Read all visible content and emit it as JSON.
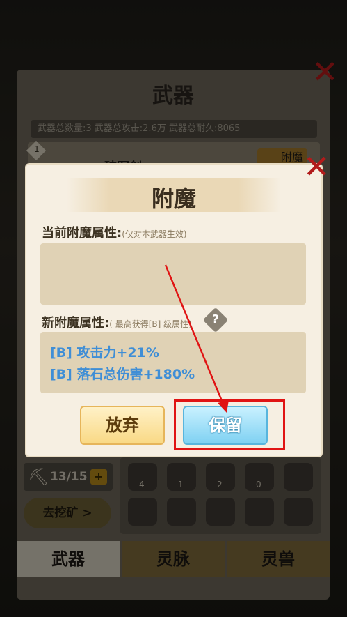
{
  "background": {
    "panel_title": "武器",
    "stats_text": "武器总数量:3  武器总攻击:2.6万  武器总耐久:8065",
    "weapon_level": "1",
    "weapon_name": "破军剑",
    "enchant_tag": "附魔",
    "pickaxe_count": "13/15",
    "plus_label": "+",
    "mine_button": "去挖矿 >",
    "ores": [
      "4",
      "1",
      "2",
      "0"
    ],
    "tabs": [
      "武器",
      "灵脉",
      "灵兽"
    ]
  },
  "dialog": {
    "title": "附魔",
    "current_label": "当前附魔属性:",
    "current_hint": "(仅对本武器生效)",
    "new_label": "新附魔属性:",
    "new_hint": "( 最高获得[B] 级属性)",
    "help_icon": "?",
    "new_attributes": [
      {
        "grade": "[B]",
        "text": "攻击力+21%"
      },
      {
        "grade": "[B]",
        "text": "落石总伤害+180%"
      }
    ],
    "abandon_button": "放弃",
    "keep_button": "保留"
  },
  "colors": {
    "attribute_text": "#3f8ed6",
    "highlight": "#e01414",
    "close_x": "#b21b1b"
  }
}
